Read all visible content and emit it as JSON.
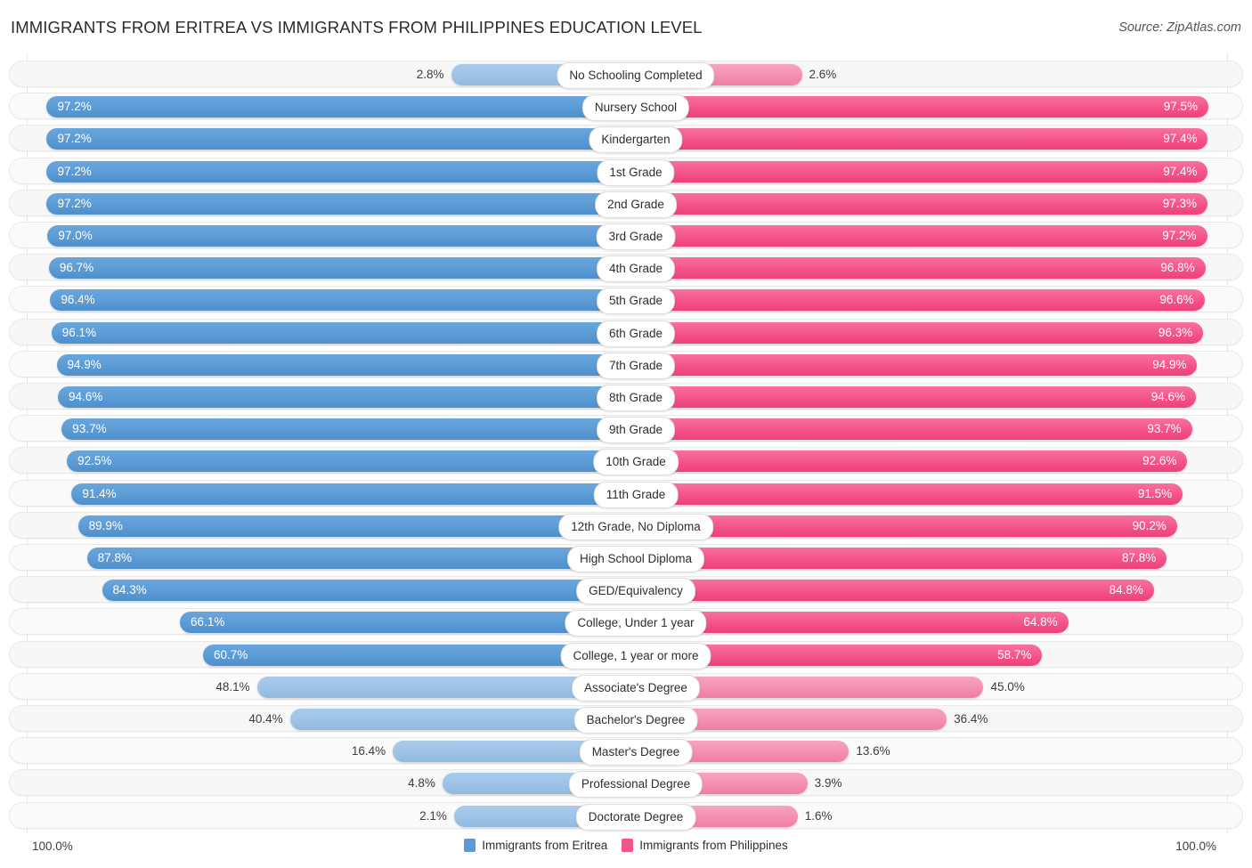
{
  "header": {
    "title": "IMMIGRANTS FROM ERITREA VS IMMIGRANTS FROM PHILIPPINES EDUCATION LEVEL",
    "source": "Source: ZipAtlas.com"
  },
  "axis": {
    "left_max": "100.0%",
    "right_max": "100.0%"
  },
  "legend": [
    {
      "label": "Immigrants from Eritrea",
      "color": "#5b9bd5"
    },
    {
      "label": "Immigrants from Philippines",
      "color": "#f4538a"
    }
  ],
  "colors": {
    "left_strong": "#5b9bd5",
    "left_light": "#9dc3e6",
    "right_strong": "#f4538a",
    "right_light": "#f48fb1",
    "track": "#f7f7f7",
    "label_pill": "#ffffff"
  },
  "chart_data": {
    "type": "bar",
    "orientation": "horizontal-diverging",
    "title": "IMMIGRANTS FROM ERITREA VS IMMIGRANTS FROM PHILIPPINES EDUCATION LEVEL",
    "xlabel": "",
    "ylabel": "",
    "xlim": [
      0,
      100
    ],
    "unit": "%",
    "grid": false,
    "legend_position": "bottom-center",
    "categories": [
      "No Schooling Completed",
      "Nursery School",
      "Kindergarten",
      "1st Grade",
      "2nd Grade",
      "3rd Grade",
      "4th Grade",
      "5th Grade",
      "6th Grade",
      "7th Grade",
      "8th Grade",
      "9th Grade",
      "10th Grade",
      "11th Grade",
      "12th Grade, No Diploma",
      "High School Diploma",
      "GED/Equivalency",
      "College, Under 1 year",
      "College, 1 year or more",
      "Associate's Degree",
      "Bachelor's Degree",
      "Master's Degree",
      "Professional Degree",
      "Doctorate Degree"
    ],
    "series": [
      {
        "name": "Immigrants from Eritrea",
        "color": "#5b9bd5",
        "values": [
          2.8,
          97.2,
          97.2,
          97.2,
          97.2,
          97.0,
          96.7,
          96.4,
          96.1,
          94.9,
          94.6,
          93.7,
          92.5,
          91.4,
          89.9,
          87.8,
          84.3,
          66.1,
          60.7,
          48.1,
          40.4,
          16.4,
          4.8,
          2.1
        ],
        "labels": [
          "2.8%",
          "97.2%",
          "97.2%",
          "97.2%",
          "97.2%",
          "97.0%",
          "96.7%",
          "96.4%",
          "96.1%",
          "94.9%",
          "94.6%",
          "93.7%",
          "92.5%",
          "91.4%",
          "89.9%",
          "87.8%",
          "84.3%",
          "66.1%",
          "60.7%",
          "48.1%",
          "40.4%",
          "16.4%",
          "4.8%",
          "2.1%"
        ]
      },
      {
        "name": "Immigrants from Philippines",
        "color": "#f4538a",
        "values": [
          2.6,
          97.5,
          97.4,
          97.4,
          97.3,
          97.2,
          96.8,
          96.6,
          96.3,
          94.9,
          94.6,
          93.7,
          92.6,
          91.5,
          90.2,
          87.8,
          84.8,
          64.8,
          58.7,
          45.0,
          36.4,
          13.6,
          3.9,
          1.6
        ],
        "labels": [
          "2.6%",
          "97.5%",
          "97.4%",
          "97.4%",
          "97.3%",
          "97.2%",
          "96.8%",
          "96.6%",
          "96.3%",
          "94.9%",
          "94.6%",
          "93.7%",
          "92.6%",
          "91.5%",
          "90.2%",
          "87.8%",
          "84.8%",
          "64.8%",
          "58.7%",
          "45.0%",
          "36.4%",
          "13.6%",
          "3.9%",
          "1.6%"
        ]
      }
    ]
  }
}
